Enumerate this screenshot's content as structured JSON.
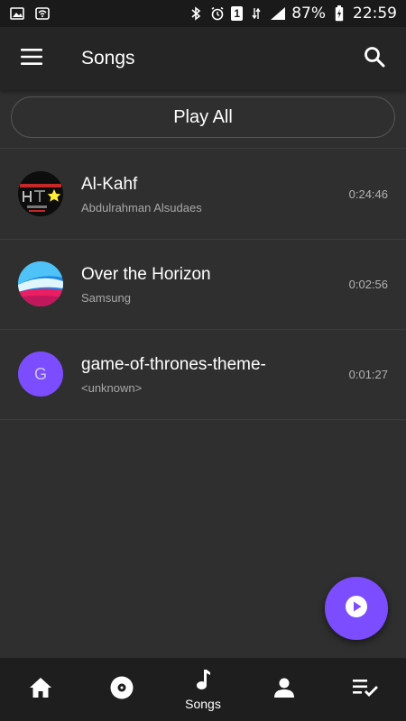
{
  "status_bar": {
    "battery": "87%",
    "time": "22:59",
    "sim_badge": "1"
  },
  "app_bar": {
    "title": "Songs",
    "menu_icon": "hamburger-menu-icon",
    "search_icon": "search-icon"
  },
  "play_all_label": "Play All",
  "songs": [
    {
      "title": "Al-Kahf",
      "artist": "Abdulrahman Alsudaes",
      "duration": "0:24:46",
      "thumb": "album-art"
    },
    {
      "title": "Over the Horizon",
      "artist": "Samsung",
      "duration": "0:02:56",
      "thumb": "album-art"
    },
    {
      "title": "game-of-thrones-theme-",
      "artist": "<unknown>",
      "duration": "0:01:27",
      "thumb_letter": "G",
      "thumb_color": "#7c4dff"
    }
  ],
  "fab_icon": "play-icon",
  "bottom_nav": [
    {
      "icon": "home-icon",
      "label": ""
    },
    {
      "icon": "album-icon",
      "label": ""
    },
    {
      "icon": "music-note-icon",
      "label": "Songs"
    },
    {
      "icon": "person-icon",
      "label": ""
    },
    {
      "icon": "playlist-check-icon",
      "label": ""
    }
  ],
  "colors": {
    "accent": "#7c4dff",
    "background": "#2f2f2f",
    "app_bar": "#252525",
    "bottom_nav": "#1e1e1e"
  }
}
